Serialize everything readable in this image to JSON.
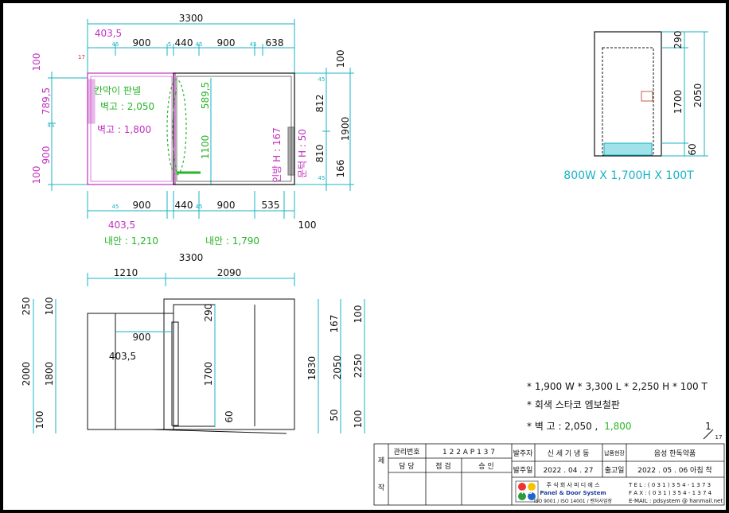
{
  "plan": {
    "top_total": "3300",
    "top_left_offset": "403,5",
    "top_segments": [
      "900",
      "440",
      "900",
      "638"
    ],
    "top_small": [
      "45",
      "45",
      "5",
      "45",
      "45",
      "45"
    ],
    "corner_num": "17",
    "left_dims": [
      "100",
      "789,5",
      "900",
      "100"
    ],
    "left_small": [
      "45"
    ],
    "right_dims": [
      "100",
      "812",
      "810",
      "166"
    ],
    "right_total": "1900",
    "right_small": [
      "45",
      "45"
    ],
    "inner_dims": [
      "589,5",
      "1100"
    ],
    "inner_small": [
      "45"
    ],
    "partition_label": "칸막이 판넬",
    "wall_height_a": "벽고 : 2,050",
    "wall_height_b": "벽고 : 1,800",
    "bottom_segments": [
      "900",
      "440",
      "900",
      "535"
    ],
    "bottom_small": [
      "45",
      "45",
      "5",
      "45",
      "45"
    ],
    "bottom_left_offset": "403,5",
    "bottom_right_dim": "100",
    "door_height": "인방 H : 167",
    "threshold_height": "문턱 H : 50",
    "interior_a": "내안 : 1,210",
    "interior_b": "내안 : 1,790"
  },
  "door_detail": {
    "dims": [
      "290",
      "1700",
      "60"
    ],
    "total": "2050",
    "caption": "800W X 1,700H X 100T"
  },
  "elevation": {
    "top_total": "3300",
    "top_segments": [
      "1210",
      "2090"
    ],
    "left_outer": [
      "250",
      "2000",
      "100"
    ],
    "left_inner": [
      "100",
      "1800",
      "100"
    ],
    "inner_width": "900",
    "inner_offset": "403,5",
    "door_dims": [
      "290",
      "1700",
      "60"
    ],
    "right_inner": [
      "167",
      "1830",
      "50"
    ],
    "right_mid": "2050",
    "right_outer": [
      "100",
      "2250",
      "100"
    ]
  },
  "spec": {
    "line1": "* 1,900 W  * 3,300 L  * 2,250 H  * 100 T",
    "line2": "* 회색 스타코 엠보철판",
    "line3_prefix": "* 벽    고 : 2,050 ,",
    "line3_highlight": "1,800"
  },
  "page": {
    "number": "1",
    "total": "17"
  },
  "title_block": {
    "side_label_top": "제",
    "side_label_bottom": "작",
    "mgmt_label": "관리번호",
    "mgmt_no": "1 2 2 A P 1 3 7",
    "charge": "담  당",
    "check": "점  검",
    "approve": "승  인",
    "orderer_label": "발주자",
    "orderer": "신 세 기 냉 동",
    "site_label": "납품현장",
    "site": "음성 한독약품",
    "order_date_label": "발주일",
    "order_date": "2022 . 04 . 27",
    "ship_date_label": "출고일",
    "ship_date": "2022 . 05 . 06  아침 착",
    "company": "주 식 회 사  피 디 에 스",
    "company_en": "Panel & Door System",
    "iso": "ISO 9001 / ISO 14001 / 벤처사업장",
    "logo_text": "PDS",
    "tel": "T E L : ( 0 3 1 ) 3 5 4 - 1 3 7 3",
    "fax": "F A X : ( 0 3 1 ) 3 5 4 - 1 3 7 4",
    "email": "E-MAIL :  pdsystem @ hanmail.net"
  },
  "colors": {
    "cyan": "#19b3c3",
    "magenta": "#c030c0",
    "green": "#28b428",
    "line": "#111111"
  }
}
